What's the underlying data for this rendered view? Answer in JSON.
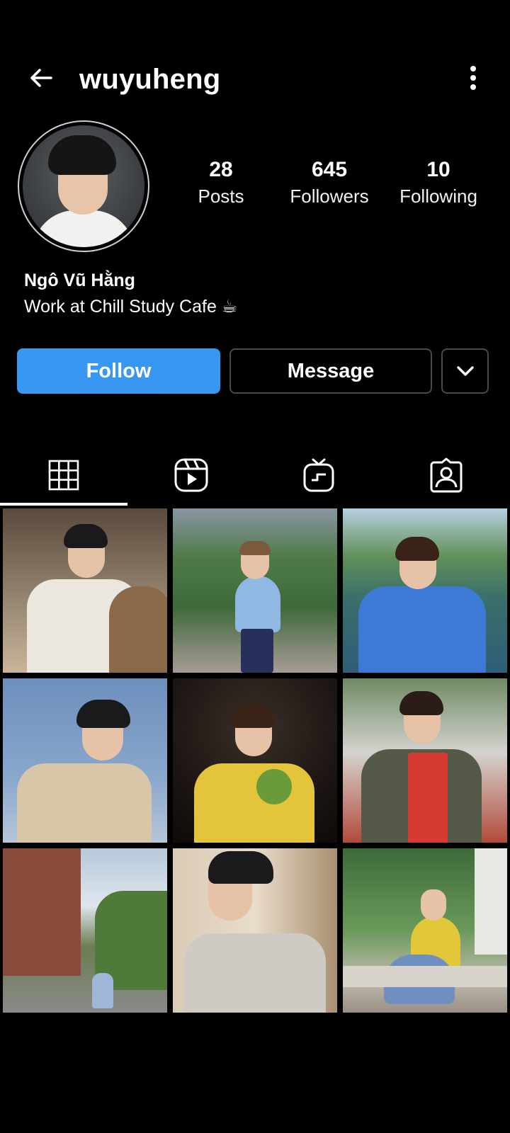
{
  "header": {
    "username": "wuyuheng"
  },
  "profile": {
    "stats": [
      {
        "value": "28",
        "label": "Posts"
      },
      {
        "value": "645",
        "label": "Followers"
      },
      {
        "value": "10",
        "label": "Following"
      }
    ],
    "display_name": "Ngô Vũ Hằng",
    "bio": "Work at Chill Study Cafe ☕"
  },
  "actions": {
    "follow_label": "Follow",
    "message_label": "Message"
  },
  "tabs": [
    {
      "icon": "grid-icon",
      "active": true
    },
    {
      "icon": "reels-icon",
      "active": false
    },
    {
      "icon": "igtv-icon",
      "active": false
    },
    {
      "icon": "tagged-icon",
      "active": false
    }
  ],
  "colors": {
    "background": "#000000",
    "follow_button": "#3897f0",
    "text": "#ffffff",
    "border": "#4a4a4a"
  }
}
